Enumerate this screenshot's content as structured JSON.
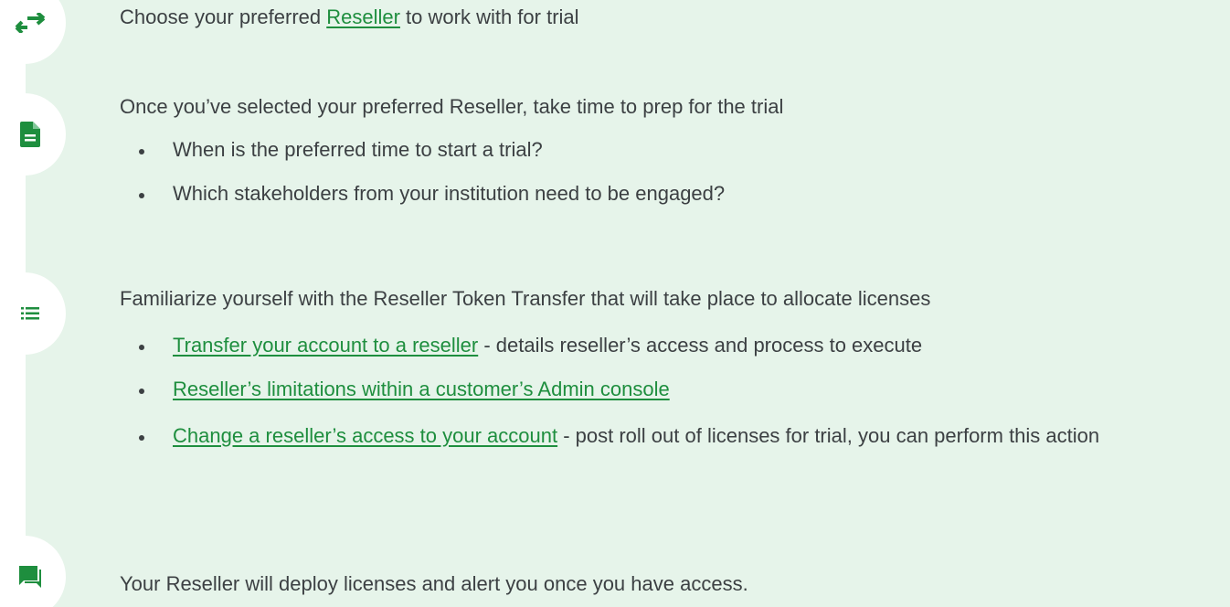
{
  "colors": {
    "accent": "#1e8e3e",
    "background": "#e6f4ea",
    "text": "#3c4043"
  },
  "steps": [
    {
      "icon": "swap-arrows-icon"
    },
    {
      "icon": "document-icon"
    },
    {
      "icon": "list-icon"
    },
    {
      "icon": "chat-icon"
    }
  ],
  "step1": {
    "prefix": "Choose your preferred ",
    "link": "Reseller",
    "suffix": " to work with for trial"
  },
  "step2": {
    "heading": "Once you’ve selected your preferred Reseller, take time to prep for the trial",
    "bullets": [
      "When is the preferred time to start a trial?",
      "Which stakeholders from your institution need to be engaged?"
    ]
  },
  "step3": {
    "heading": "Familiarize yourself with the Reseller Token Transfer that will take place to allocate licenses",
    "items": [
      {
        "link": "Transfer your account to a reseller",
        "text": " - details reseller’s access and process to execute"
      },
      {
        "link": "Reseller’s limitations within a customer’s Admin console",
        "text": ""
      },
      {
        "link": "Change a reseller’s access to your account",
        "text": " - post roll out of licenses for trial, you can perform this action"
      }
    ]
  },
  "step4": {
    "text": "Your Reseller will deploy licenses and alert you once you have access."
  }
}
